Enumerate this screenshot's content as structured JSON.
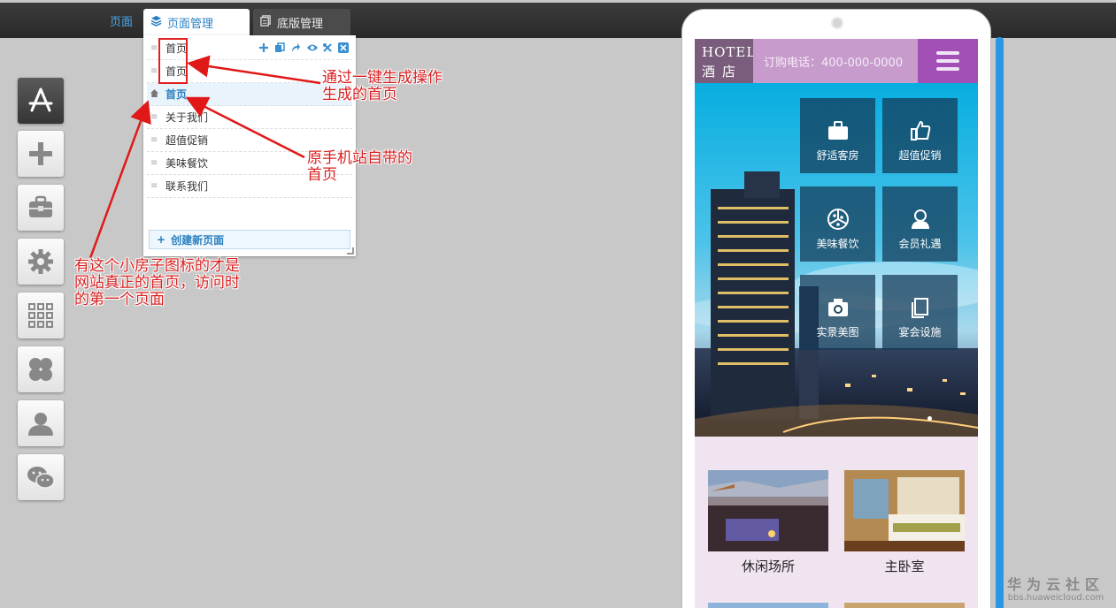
{
  "topbar": {
    "page_link": "页面",
    "tabs": [
      {
        "label": "页面管理",
        "active": true
      },
      {
        "label": "底版管理",
        "active": false
      }
    ]
  },
  "toolbar": {
    "buttons": [
      "app-store-icon",
      "plus-icon",
      "toolbox-icon",
      "gear-icon",
      "grid-icon",
      "clover-icon",
      "user-icon",
      "wechat-icon"
    ]
  },
  "page_list": {
    "items": [
      "首页",
      "首页",
      "首页",
      "关于我们",
      "超值促销",
      "美味餐饮",
      "联系我们"
    ],
    "home_index": 2,
    "create_label": "创建新页面"
  },
  "annotations": {
    "generated": [
      "通过一键生成操作",
      "生成的首页"
    ],
    "original": [
      "原手机站自带的",
      "首页"
    ],
    "house": [
      "有这个小房子图标的才是",
      "网站真正的首页，访问时",
      "的第一个页面"
    ]
  },
  "phone": {
    "logo_line1": "HOTEL",
    "logo_line2": "酒店",
    "phone_text": "订购电话：400-000-0000",
    "tiles": [
      "舒适客房",
      "超值促销",
      "美味餐饮",
      "会员礼遇",
      "实景美图",
      "宴会设施"
    ],
    "thumbs": [
      "休闲场所",
      "主卧室"
    ]
  },
  "watermark": {
    "name": "华为云社区",
    "url": "bbs.huaweicloud.com"
  },
  "colors": {
    "accent_blue": "#2a7fc0",
    "annotation_red": "#d81f1f",
    "phone_purple": "#a24fb6",
    "phone_lilac": "#c79ccd",
    "phone_bg": "#f1e4f1"
  }
}
